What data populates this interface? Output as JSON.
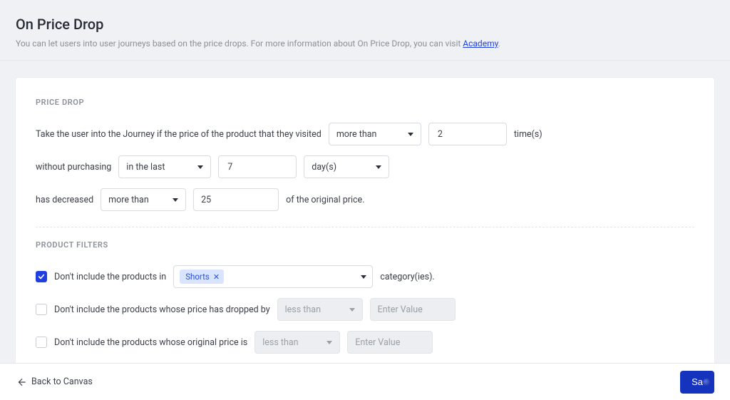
{
  "header": {
    "title": "On Price Drop",
    "subtitle_prefix": "You can let users into user journeys based on the price drops. For more information about On Price Drop, you can visit ",
    "subtitle_link": "Academy",
    "subtitle_suffix": "."
  },
  "price_drop": {
    "section_label": "PRICE DROP",
    "line1_prefix": "Take the user into the Journey if the price of the product that they visited",
    "compare1": "more than",
    "visits_value": "2",
    "line1_suffix": "time(s)",
    "line2_prefix": "without purchasing",
    "window_select": "in the last",
    "window_value": "7",
    "window_unit": "day(s)",
    "line3_prefix": "has decreased",
    "compare2": "more than",
    "percent_value": "25",
    "percent_unit": "%",
    "line3_suffix": "of the original price."
  },
  "product_filters": {
    "section_label": "PRODUCT FILTERS",
    "rule1_label": "Don't include the products in",
    "rule1_chip": "Shorts",
    "rule1_suffix": "category(ies).",
    "rule2_label": "Don't include the products whose price has dropped by",
    "rule2_compare": "less than",
    "rule2_placeholder": "Enter Value",
    "rule2_unit": "$",
    "rule3_label": "Don't include the products whose original price is",
    "rule3_compare": "less than",
    "rule3_placeholder": "Enter Value",
    "rule3_unit": "$"
  },
  "footer": {
    "back_label": "Back to Canvas",
    "save_label": "Sa"
  }
}
